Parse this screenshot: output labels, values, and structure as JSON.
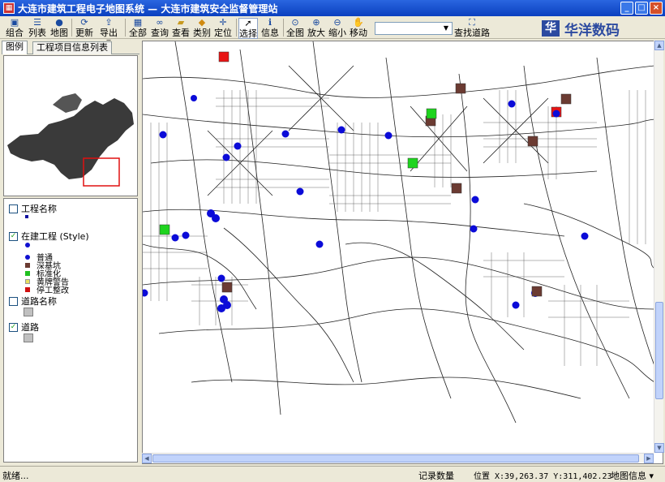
{
  "window": {
    "title": "大连市建筑工程电子地图系统 — 大连市建筑安全监督管理站",
    "controls": [
      "_",
      "□",
      "×"
    ]
  },
  "toolbar": {
    "buttons": [
      {
        "label": "组合",
        "icon": "combine-icon"
      },
      {
        "label": "列表",
        "icon": "list-icon"
      },
      {
        "label": "地图",
        "icon": "map-icon"
      },
      {
        "label": "更新",
        "icon": "refresh-icon"
      },
      {
        "label": "导出",
        "icon": "export-icon"
      },
      {
        "label": "全部",
        "icon": "grid-icon"
      },
      {
        "label": "查询",
        "icon": "binoculars-icon"
      },
      {
        "label": "查看",
        "icon": "folder-icon"
      },
      {
        "label": "类别",
        "icon": "category-icon"
      },
      {
        "label": "定位",
        "icon": "crosshair-icon"
      },
      {
        "label": "选择",
        "icon": "pointer-icon"
      },
      {
        "label": "信息",
        "icon": "info-icon"
      },
      {
        "label": "全图",
        "icon": "full-extent-icon"
      },
      {
        "label": "放大",
        "icon": "zoom-in-icon"
      },
      {
        "label": "缩小",
        "icon": "zoom-out-icon"
      },
      {
        "label": "移动",
        "icon": "hand-icon"
      }
    ],
    "find_road_label": "查找道路",
    "road_combo_value": ""
  },
  "logo": {
    "mark": "华",
    "text": "华洋数码"
  },
  "left_panel": {
    "tabs": [
      "图例",
      "工程项目信息列表"
    ],
    "legend": {
      "project_name": "工程名称",
      "construction_layer": "在建工程 (Style)",
      "categories": [
        {
          "label": "普通",
          "color": "#1010d0"
        },
        {
          "label": "深基坑",
          "color": "#6b3b32"
        },
        {
          "label": "标准化",
          "color": "#20c020"
        },
        {
          "label": "黄牌警告",
          "color": "#e8e060"
        },
        {
          "label": "停工整改",
          "color": "#d01010"
        }
      ],
      "road_name": "道路名称",
      "road": "道路",
      "checked": {
        "project_name": false,
        "construction_layer": true,
        "road_name": false,
        "road": true
      }
    }
  },
  "map": {
    "marker_colors": {
      "normal": "#0b0bd8",
      "deep_pit": "#6b3b32",
      "standard": "#1ed41e",
      "stopped": "#e81414"
    }
  },
  "status": {
    "ready": "就绪...",
    "record_count_label": "记录数量",
    "position": "位置 X:39,263.37 Y:311,402.23",
    "map_info": "地图信息"
  }
}
